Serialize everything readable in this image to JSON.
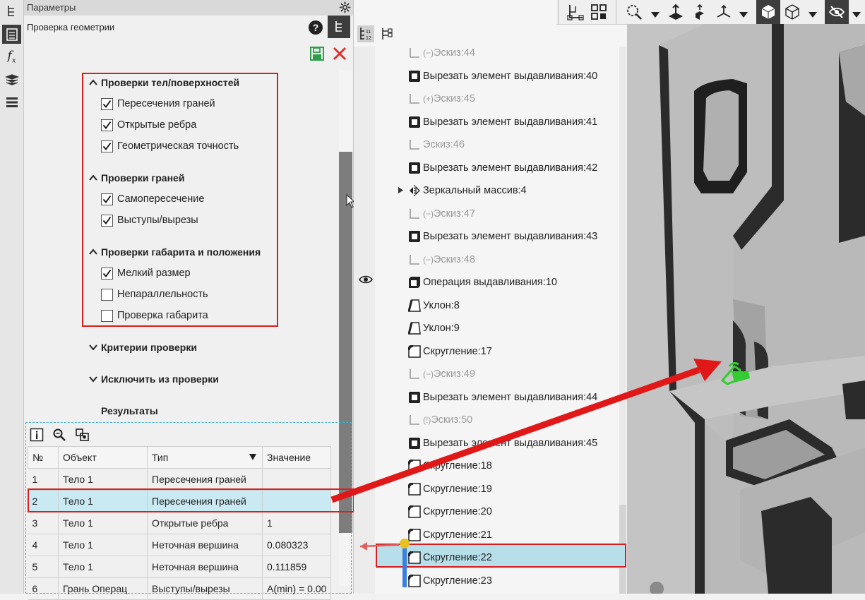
{
  "panel": {
    "header_title": "Параметры",
    "subtitle": "Проверка геометрии"
  },
  "sections": {
    "bodies": {
      "title": "Проверки тел/поверхностей",
      "items": [
        {
          "label": "Пересечения граней",
          "checked": true
        },
        {
          "label": "Открытые ребра",
          "checked": true
        },
        {
          "label": "Геометрическая точность",
          "checked": true
        }
      ]
    },
    "faces": {
      "title": "Проверки граней",
      "items": [
        {
          "label": "Самопересечение",
          "checked": true
        },
        {
          "label": "Выступы/вырезы",
          "checked": true
        }
      ]
    },
    "dims": {
      "title": "Проверки габарита и положения",
      "items": [
        {
          "label": "Мелкий размер",
          "checked": true
        },
        {
          "label": "Непараллельность",
          "checked": false
        },
        {
          "label": "Проверка габарита",
          "checked": false
        }
      ]
    },
    "criteria": {
      "title": "Критерии проверки"
    },
    "exclude": {
      "title": "Исключить из проверки"
    },
    "results": {
      "title": "Результаты"
    }
  },
  "results_table": {
    "columns": [
      "№",
      "Объект",
      "Тип",
      "Значение"
    ],
    "rows": [
      {
        "n": "1",
        "obj": "Тело 1",
        "type": "Пересечения граней",
        "val": ""
      },
      {
        "n": "2",
        "obj": "Тело 1",
        "type": "Пересечения граней",
        "val": ""
      },
      {
        "n": "3",
        "obj": "Тело 1",
        "type": "Открытые ребра",
        "val": "1"
      },
      {
        "n": "4",
        "obj": "Тело 1",
        "type": "Неточная вершина",
        "val": "0.080323"
      },
      {
        "n": "5",
        "obj": "Тело 1",
        "type": "Неточная вершина",
        "val": "0.111859"
      },
      {
        "n": "6",
        "obj": "Грань Операц",
        "type": "Выступы/вырезы",
        "val": "A(min) = 0.00"
      }
    ],
    "selected_row": 1
  },
  "tree": {
    "items": [
      {
        "label": "Эскиз:44",
        "kind": "sketch-minus",
        "faded": true
      },
      {
        "label": "Вырезать элемент выдавливания:40",
        "kind": "cut",
        "faded": false
      },
      {
        "label": "Эскиз:45",
        "kind": "sketch-plus",
        "faded": true
      },
      {
        "label": "Вырезать элемент выдавливания:41",
        "kind": "cut",
        "faded": false
      },
      {
        "label": "Эскиз:46",
        "kind": "sketch",
        "faded": true
      },
      {
        "label": "Вырезать элемент выдавливания:42",
        "kind": "cut",
        "faded": false
      },
      {
        "label": "Зеркальный массив:4",
        "kind": "mirror",
        "faded": false
      },
      {
        "label": "Эскиз:47",
        "kind": "sketch-minus",
        "faded": true
      },
      {
        "label": "Вырезать элемент выдавливания:43",
        "kind": "cut",
        "faded": false
      },
      {
        "label": "Эскиз:48",
        "kind": "sketch-minus",
        "faded": true
      },
      {
        "label": "Операция выдавливания:10",
        "kind": "extrude",
        "faded": false
      },
      {
        "label": "Уклон:8",
        "kind": "draft",
        "faded": false
      },
      {
        "label": "Уклон:9",
        "kind": "draft",
        "faded": false
      },
      {
        "label": "Скругление:17",
        "kind": "fillet",
        "faded": false
      },
      {
        "label": "Эскиз:49",
        "kind": "sketch-minus",
        "faded": true
      },
      {
        "label": "Вырезать элемент выдавливания:44",
        "kind": "cut",
        "faded": false
      },
      {
        "label": "Эскиз:50",
        "kind": "sketch-excl",
        "faded": true
      },
      {
        "label": "Вырезать элемент выдавливания:45",
        "kind": "cut",
        "faded": false
      },
      {
        "label": "Скругление:18",
        "kind": "fillet",
        "faded": false
      },
      {
        "label": "Скругление:19",
        "kind": "fillet",
        "faded": false
      },
      {
        "label": "Скругление:20",
        "kind": "fillet",
        "faded": false
      },
      {
        "label": "Скругление:21",
        "kind": "fillet",
        "faded": false
      },
      {
        "label": "Скругление:22",
        "kind": "fillet",
        "faded": false,
        "selected": true
      },
      {
        "label": "Скругление:23",
        "kind": "fillet",
        "faded": false
      }
    ],
    "sketch_marks": {
      "minus": "(−)",
      "plus": "(+)",
      "excl": "(!)"
    }
  },
  "colors": {
    "highlight_red": "#d42020",
    "selection_blue": "#c9e9f3",
    "tree_selection": "#b6dfea",
    "save_green": "#2f9e4a",
    "close_red": "#e03030",
    "part_surface": "#b9b9b9",
    "part_dark": "#2b2b2b",
    "error_green": "#33cc33"
  }
}
